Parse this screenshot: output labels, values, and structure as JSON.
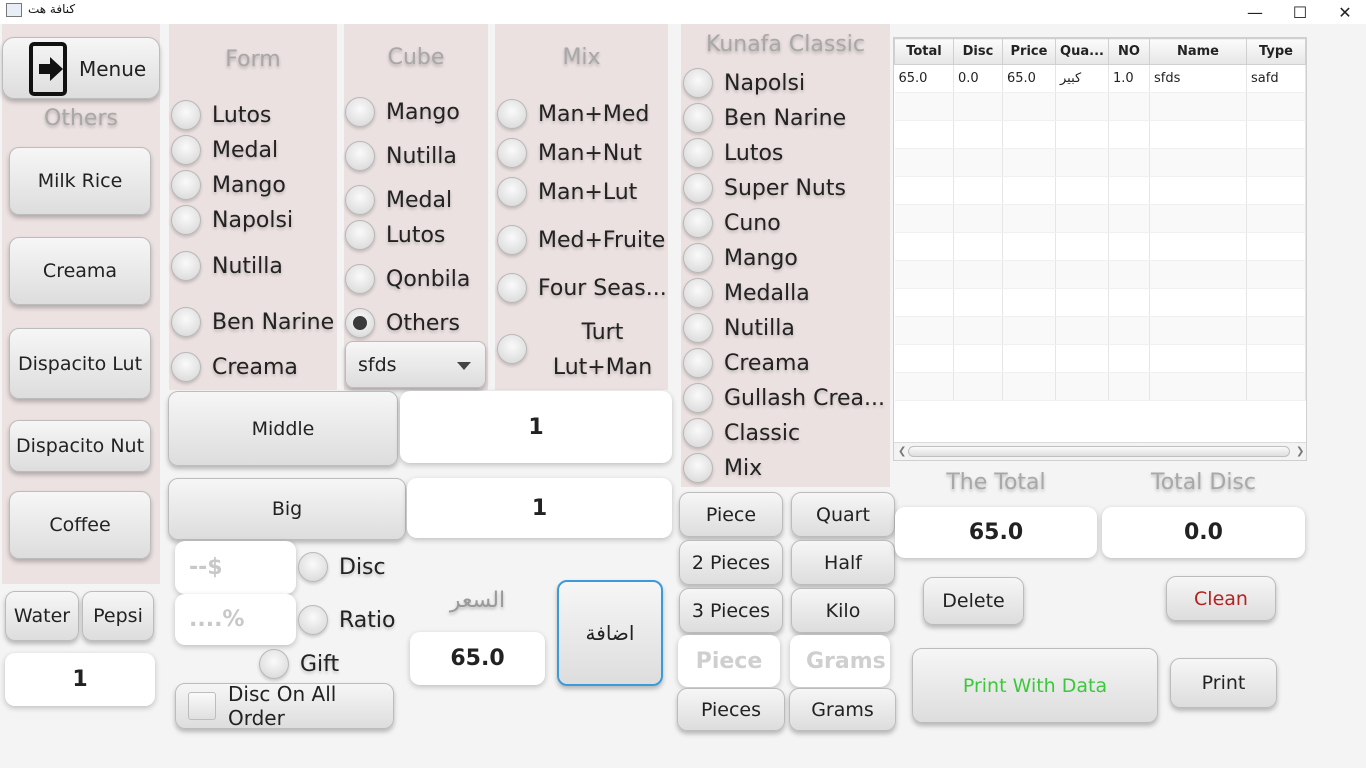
{
  "window": {
    "title": "كنافة هت",
    "minimize": "—",
    "maximize": "☐",
    "close": "✕"
  },
  "left": {
    "menu_label": "Menue",
    "others_header": "Others",
    "items": [
      "Milk Rice",
      "Creama",
      "Dispacito Lut",
      "Dispacito Nut",
      "Coffee"
    ],
    "water": "Water",
    "pepsi": "Pepsi",
    "qty": "1"
  },
  "form": {
    "header": "Form",
    "options": [
      "Lutos",
      "Medal",
      "Mango",
      "Napolsi",
      "Nutilla",
      "Ben Narine",
      "Creama"
    ]
  },
  "cube": {
    "header": "Cube",
    "options": [
      "Mango",
      "Nutilla",
      "Medal",
      "Lutos",
      "Qonbila",
      "Others"
    ],
    "selected": "Others",
    "dropdown_value": "sfds"
  },
  "mix": {
    "header": "Mix",
    "options": [
      "Man+Med",
      "Man+Nut",
      "Man+Lut",
      "Med+Fruite",
      "Four Seas...",
      "Turt Lut+Man"
    ]
  },
  "kunafa": {
    "header": "Kunafa Classic",
    "options": [
      "Napolsi",
      "Ben Narine",
      "Lutos",
      "Super Nuts",
      "Cuno",
      "Mango",
      "Medalla",
      "Nutilla",
      "Creama",
      "Gullash Crea...",
      "Classic",
      "Mix"
    ]
  },
  "size": {
    "middle_label": "Middle",
    "middle_qty": "1",
    "big_label": "Big",
    "big_qty": "1"
  },
  "discount": {
    "amount_placeholder": "--$",
    "percent_placeholder": "....%",
    "disc_label": "Disc",
    "ratio_label": "Ratio",
    "gift_label": "Gift",
    "all_order_label": "Disc On All Order"
  },
  "price": {
    "label": "السعر",
    "value": "65.0",
    "add_label": "اضافة"
  },
  "units": {
    "piece": "Piece",
    "quart": "Quart",
    "two_pieces": "2 Pieces",
    "half": "Half",
    "three_pieces": "3 Pieces",
    "kilo": "Kilo",
    "piece_input": "Piece",
    "grams_input": "Grams",
    "pieces": "Pieces",
    "grams": "Grams"
  },
  "table": {
    "columns": [
      "Total",
      "Disc",
      "Price",
      "Qua...",
      "NO",
      "Name",
      "Type"
    ],
    "rows": [
      [
        "65.0",
        "0.0",
        "65.0",
        "كبير",
        "1.0",
        "sfds",
        "safd"
      ]
    ]
  },
  "totals": {
    "total_label": "The Total",
    "total_value": "65.0",
    "disc_label": "Total Disc",
    "disc_value": "0.0"
  },
  "actions": {
    "delete": "Delete",
    "clean": "Clean",
    "print_with_data": "Print With Data",
    "print": "Print"
  },
  "colors": {
    "clean_text": "#b22222",
    "print_with_data_text": "#3cc83c",
    "add_border": "#3b9ad9",
    "panel": "#ece1e1"
  }
}
